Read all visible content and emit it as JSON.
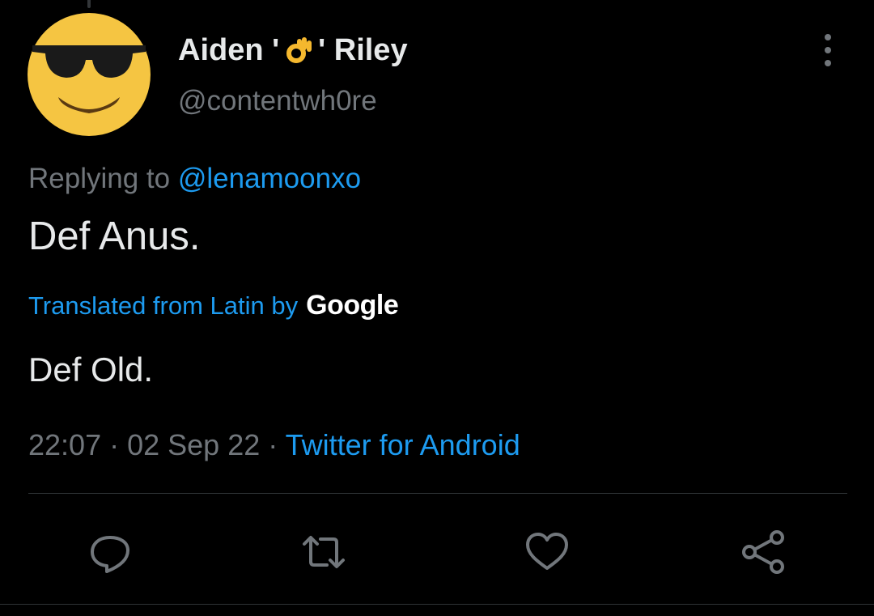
{
  "author": {
    "name_before": "Aiden '",
    "name_emoji": "ok-hand-emoji",
    "name_after": "' Riley",
    "handle": "@contentwh0re",
    "avatar": "sunglasses-face"
  },
  "reply": {
    "prefix": "Replying to ",
    "mention": "@lenamoonxo"
  },
  "tweet": {
    "text": "Def Anus."
  },
  "translation": {
    "label": "Translated from Latin by",
    "provider": "Google",
    "text": "Def Old."
  },
  "meta": {
    "time": "22:07",
    "separator": " · ",
    "date": "02 Sep 22",
    "source": "Twitter for Android"
  },
  "actions": [
    {
      "icon": "reply-icon"
    },
    {
      "icon": "retweet-icon"
    },
    {
      "icon": "like-icon"
    },
    {
      "icon": "share-icon"
    }
  ],
  "colors": {
    "background": "#000000",
    "text_primary": "#e7e9ea",
    "text_secondary": "#71767b",
    "accent": "#1d9bf0",
    "avatar_yellow": "#f5c542"
  }
}
